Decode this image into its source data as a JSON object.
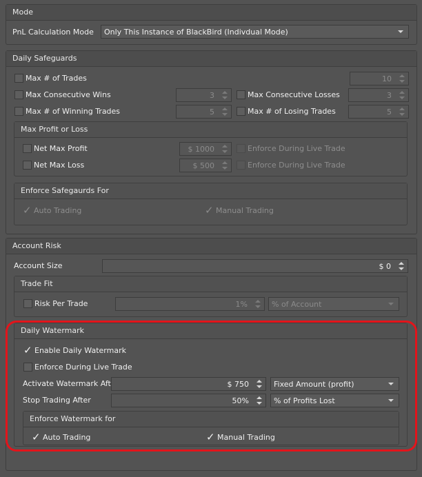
{
  "mode": {
    "title": "Mode",
    "pnl_label": "PnL Calculation Mode",
    "pnl_value": "Only This Instance of BlackBird (Indivdual Mode)"
  },
  "daily": {
    "title": "Daily Safeguards",
    "max_trades_label": "Max # of Trades",
    "max_trades_value": "10",
    "max_consec_wins_label": "Max Consecutive Wins",
    "max_consec_wins_value": "3",
    "max_consec_losses_label": "Max Consecutive Losses",
    "max_consec_losses_value": "3",
    "max_winning_label": "Max # of Winning Trades",
    "max_winning_value": "5",
    "max_losing_label": "Max # of Losing Trades",
    "max_losing_value": "5",
    "profit_loss": {
      "title": "Max Profit or Loss",
      "net_max_profit_label": "Net Max Profit",
      "net_max_profit_value": "$ 1000",
      "enforce_live_1": "Enforce During Live Trade",
      "net_max_loss_label": "Net Max Loss",
      "net_max_loss_value": "$ 500",
      "enforce_live_2": "Enforce During Live Trade"
    },
    "enforce": {
      "title": "Enforce Safegaurds For",
      "auto_label": "Auto Trading",
      "manual_label": "Manual Trading"
    }
  },
  "risk": {
    "title": "Account Risk",
    "account_size_label": "Account Size",
    "account_size_value": "$ 0",
    "trade_fit": {
      "title": "Trade Fit",
      "risk_label": "Risk Per Trade",
      "risk_value": "1%",
      "risk_mode": "% of Account"
    },
    "watermark": {
      "title": "Daily Watermark",
      "enable_label": "Enable Daily Watermark",
      "enforce_live_label": "Enforce During Live Trade",
      "activate_label": "Activate Watermark After",
      "activate_value": "$ 750",
      "activate_mode": "Fixed Amount (profit)",
      "stop_label": "Stop Trading After",
      "stop_value": "50%",
      "stop_mode": "% of Profits Lost",
      "enforce_for": {
        "title": "Enforce Watermark for",
        "auto_label": "Auto Trading",
        "manual_label": "Manual Trading"
      }
    }
  },
  "colors": {
    "background": "#535353",
    "highlight": "#e3141b"
  },
  "icons": {
    "check": "✓"
  }
}
